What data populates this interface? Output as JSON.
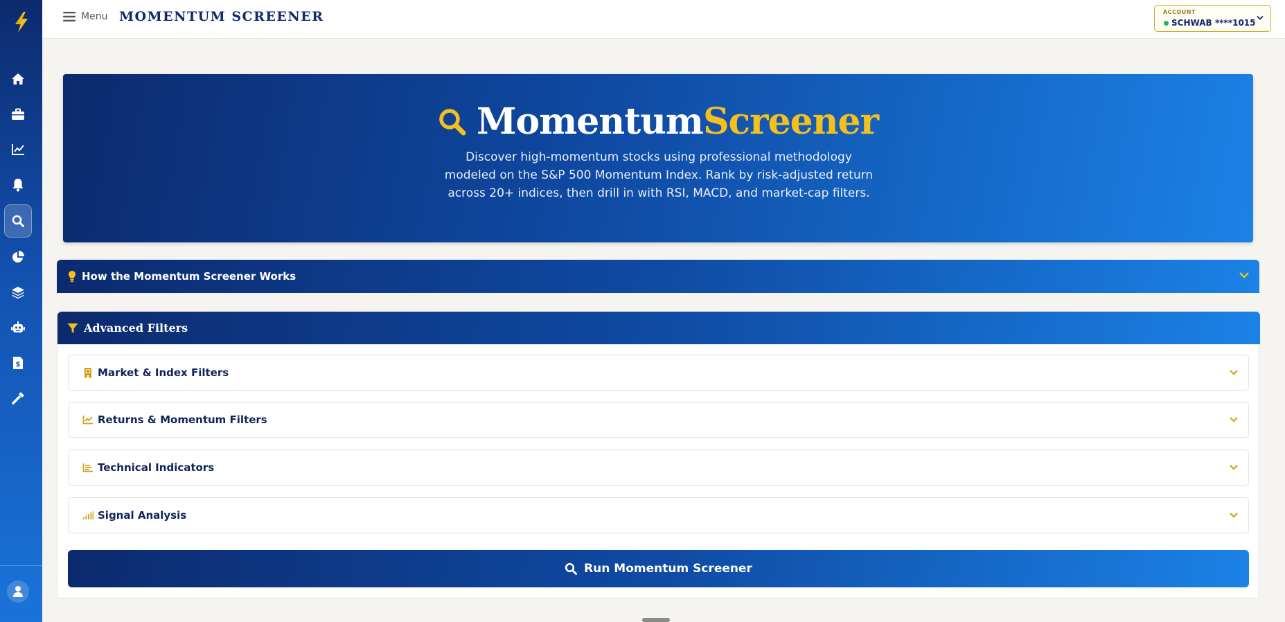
{
  "topbar": {
    "menu_label": "Menu",
    "app_title": "MOMENTUM SCREENER",
    "account": {
      "label": "ACCOUNT",
      "broker": "SCHWAB",
      "number": "****1015",
      "status_color": "#22b356"
    }
  },
  "sidebar": {
    "items": [
      {
        "icon": "home-icon"
      },
      {
        "icon": "briefcase-icon"
      },
      {
        "icon": "chart-line-icon"
      },
      {
        "icon": "bell-icon"
      },
      {
        "icon": "search-icon",
        "active": true
      },
      {
        "icon": "pie-chart-icon"
      },
      {
        "icon": "layers-icon"
      },
      {
        "icon": "robot-icon"
      },
      {
        "icon": "invoice-icon"
      },
      {
        "icon": "tools-icon"
      }
    ],
    "user_icon": "user-icon"
  },
  "hero": {
    "title_part1": "Momentum",
    "title_part2": "Screener",
    "description": "Discover high-momentum stocks using professional methodology modeled on the S&P 500 Momentum Index. Rank by risk-adjusted return across 20+ indices, then drill in with RSI, MACD, and market-cap filters."
  },
  "how_it_works": {
    "label": "How the Momentum Screener Works"
  },
  "advanced_filters": {
    "title": "Advanced Filters",
    "sections": [
      {
        "label": "Market & Index Filters",
        "icon": "building-icon"
      },
      {
        "label": "Returns & Momentum Filters",
        "icon": "chart-line-icon"
      },
      {
        "label": "Technical Indicators",
        "icon": "bar-chart-icon"
      },
      {
        "label": "Signal Analysis",
        "icon": "signal-icon"
      }
    ],
    "run_button": "Run Momentum Screener"
  },
  "colors": {
    "navy": "#0c2a6e",
    "blue": "#1b82e6",
    "gold": "#f4c01e",
    "gold_dark": "#d4a017"
  }
}
